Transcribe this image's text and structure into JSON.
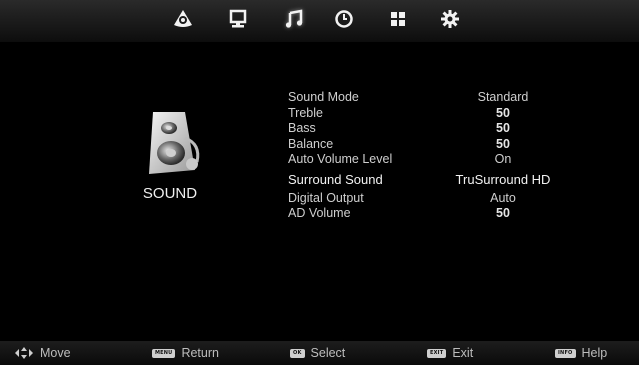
{
  "tabs": [
    {
      "name": "picture",
      "icon": "picture-icon",
      "selected": false
    },
    {
      "name": "channel",
      "icon": "monitor-icon",
      "selected": false
    },
    {
      "name": "sound",
      "icon": "music-note-icon",
      "selected": true
    },
    {
      "name": "time",
      "icon": "clock-icon",
      "selected": false
    },
    {
      "name": "lock",
      "icon": "grid-icon",
      "selected": false
    },
    {
      "name": "setup",
      "icon": "gear-icon",
      "selected": false
    }
  ],
  "section": {
    "title": "SOUND",
    "icon": "speaker-icon"
  },
  "settings": [
    {
      "label": "Sound Mode",
      "value": "Standard"
    },
    {
      "label": "Treble",
      "value": "50"
    },
    {
      "label": "Bass",
      "value": "50"
    },
    {
      "label": "Balance",
      "value": "50"
    },
    {
      "label": "Auto Volume Level",
      "value": "On"
    },
    {
      "label": "Surround Sound",
      "value": "TruSurround HD"
    },
    {
      "label": "Digital Output",
      "value": "Auto"
    },
    {
      "label": "AD Volume",
      "value": "50"
    }
  ],
  "footer": {
    "move": {
      "label": "Move",
      "icon": "nav-arrows-icon"
    },
    "return": {
      "label": "Return",
      "key": "MENU"
    },
    "select": {
      "label": "Select",
      "key": "OK"
    },
    "exit": {
      "label": "Exit",
      "key": "EXIT"
    },
    "help": {
      "label": "Help",
      "key": "INFO"
    }
  },
  "colors": {
    "background": "#000000",
    "text": "#d8d8d8",
    "bar": "#1a1a1a"
  }
}
